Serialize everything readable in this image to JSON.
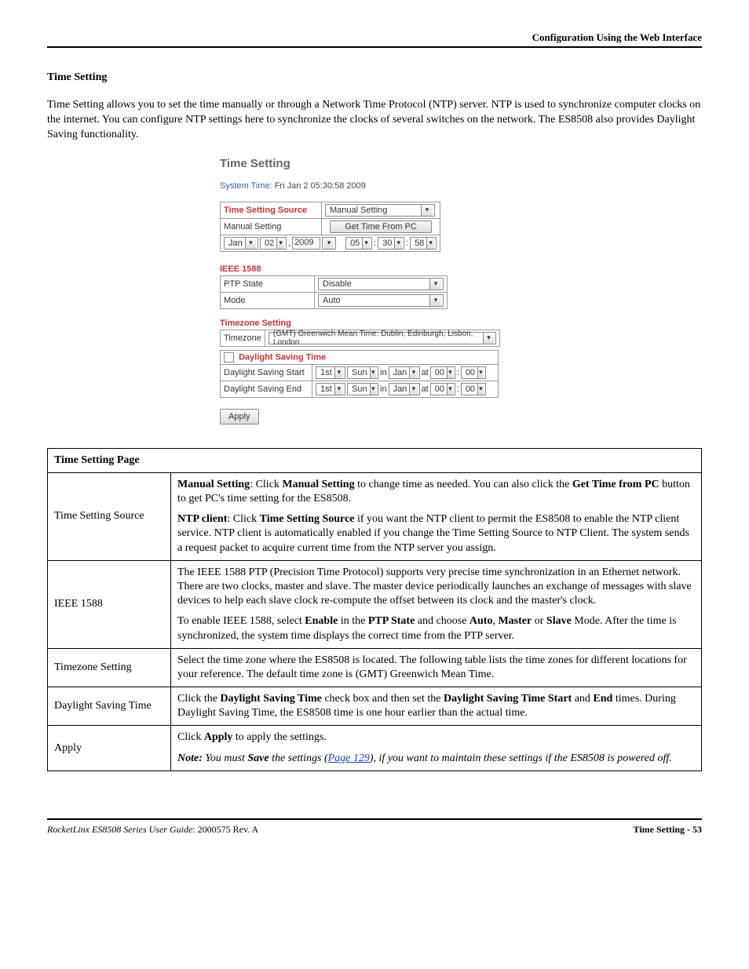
{
  "header": {
    "right": "Configuration Using the Web Interface"
  },
  "page": {
    "heading": "Time Setting",
    "intro": "Time Setting allows you to set the time manually or through a Network Time Protocol (NTP) server. NTP is used to synchronize computer clocks on the internet. You can configure NTP settings here to synchronize the clocks of several switches on the network. The ES8508 also provides Daylight Saving functionality."
  },
  "screenshot": {
    "title": "Time Setting",
    "systime_label": "System Time:",
    "systime_value": "Fri Jan 2 05:30:58 2009",
    "source": {
      "label": "Time Setting Source",
      "value": "Manual Setting",
      "manual_label": "Manual Setting",
      "button": "Get Time From PC",
      "month": "Jan",
      "day": "02",
      "year": "2009",
      "hour": "05",
      "min": "30",
      "sec": "58"
    },
    "ieee": {
      "heading": "IEEE 1588",
      "ptp_label": "PTP State",
      "ptp_value": "Disable",
      "mode_label": "Mode",
      "mode_value": "Auto"
    },
    "tz": {
      "heading": "Timezone Setting",
      "label": "Timezone",
      "value": "(GMT) Greenwich Mean Time: Dublin, Edinburgh, Lisbon, London"
    },
    "dst": {
      "heading": "Daylight Saving Time",
      "start_label": "Daylight Saving Start",
      "end_label": "Daylight Saving End",
      "nth": "1st",
      "day": "Sun",
      "in": "in",
      "month": "Jan",
      "at": "at",
      "hh": "00",
      "mm": "00"
    },
    "apply": "Apply"
  },
  "table": {
    "title": "Time Setting Page",
    "rows": [
      {
        "label": "Time Setting Source",
        "p1_pre": "Manual Setting",
        "p1_mid1": ": Click ",
        "p1_b2": "Manual Setting",
        "p1_mid2": " to change time as needed. You can also click the ",
        "p1_b3": "Get Time from PC",
        "p1_end": " button to get PC's time setting for the ES8508.",
        "p2_pre": "NTP client",
        "p2_mid1": ": Click ",
        "p2_b2": "Time Setting Source",
        "p2_end": " if you want the NTP client to permit the ES8508 to enable the NTP client service. NTP client is automatically enabled if you change the Time Setting Source to NTP Client. The system sends a request packet to acquire current time from the NTP server you assign."
      },
      {
        "label": "IEEE 1588",
        "p1": "The IEEE 1588 PTP (Precision Time Protocol) supports very precise time synchronization in an Ethernet network. There are two clocks, master and slave. The master device periodically launches an exchange of messages with slave devices to help each slave clock re-compute the offset between its clock and the master's clock.",
        "p2_pre": "To enable IEEE 1588, select ",
        "p2_b1": "Enable",
        "p2_mid1": " in the ",
        "p2_b2": "PTP State",
        "p2_mid2": " and choose ",
        "p2_b3": "Auto",
        "p2_mid3": ", ",
        "p2_b4": "Master",
        "p2_mid4": " or ",
        "p2_b5": "Slave",
        "p2_end": " Mode. After the time is synchronized, the system time displays the correct time from the PTP server."
      },
      {
        "label": "Timezone Setting",
        "p1": "Select the time zone where the ES8508 is located. The following table lists the time zones for different locations for your reference. The default time zone is (GMT) Greenwich Mean Time."
      },
      {
        "label": "Daylight Saving Time",
        "p1_pre": "Click the ",
        "p1_b1": "Daylight Saving Time",
        "p1_mid1": " check box and then set the ",
        "p1_b2": "Daylight Saving Time Start",
        "p1_mid2": " and ",
        "p1_b3": "End",
        "p1_end": " times. During Daylight Saving Time, the ES8508 time is one hour earlier than the actual time."
      },
      {
        "label": "Apply",
        "p1_pre": "Click ",
        "p1_b1": "Apply",
        "p1_end": " to apply the settings.",
        "note_label": "Note:",
        "note_mid1": " You must ",
        "note_b1": "Save",
        "note_mid2": " the settings (",
        "note_link": "Page 129",
        "note_end": "), if you want to maintain these settings if the ES8508 is powered off."
      }
    ]
  },
  "footer": {
    "left_italic": "RocketLinx ES8508 Series  User Guide",
    "left_norm": ": 2000575 Rev. A",
    "right": "Time Setting - 53"
  }
}
